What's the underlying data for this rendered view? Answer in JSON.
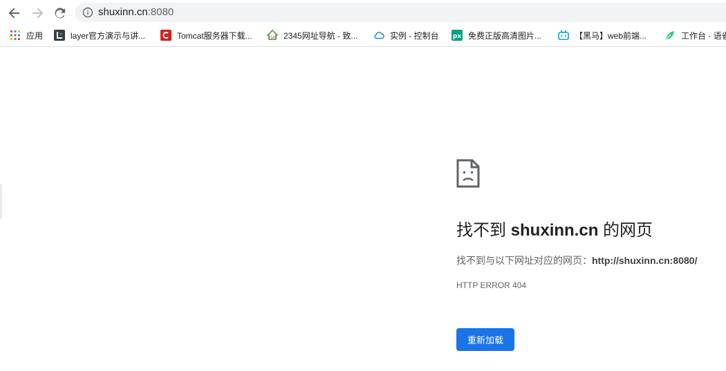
{
  "browser": {
    "url_host": "shuxinn.cn",
    "url_port": ":8080"
  },
  "bookmarks": [
    {
      "label": "应用",
      "icon": "apps-grid-icon"
    },
    {
      "label": "layer官方演示与讲...",
      "icon": "layer-icon"
    },
    {
      "label": "Tomcat服务器下载...",
      "icon": "tomcat-icon"
    },
    {
      "label": "2345网址导航 - 致...",
      "icon": "2345-icon"
    },
    {
      "label": "实例 - 控制台",
      "icon": "cloud-icon"
    },
    {
      "label": "免费正版高清图片...",
      "icon": "pexels-icon"
    },
    {
      "label": "【黑马】web前端...",
      "icon": "bilibili-icon"
    },
    {
      "label": "工作台 · 语雀",
      "icon": "yuque-icon"
    }
  ],
  "error": {
    "title_prefix": "找不到 ",
    "title_host": "shuxinn.cn",
    "title_suffix": " 的网页",
    "desc_prefix": "找不到与以下网址对应的网页：",
    "desc_url": "http://shuxinn.cn:8080/",
    "code": "HTTP ERROR 404",
    "reload_label": "重新加载"
  },
  "colors": {
    "accent": "#1a73e8",
    "omnibox_bg": "#f1f3f4",
    "text_secondary": "#5f6368"
  }
}
